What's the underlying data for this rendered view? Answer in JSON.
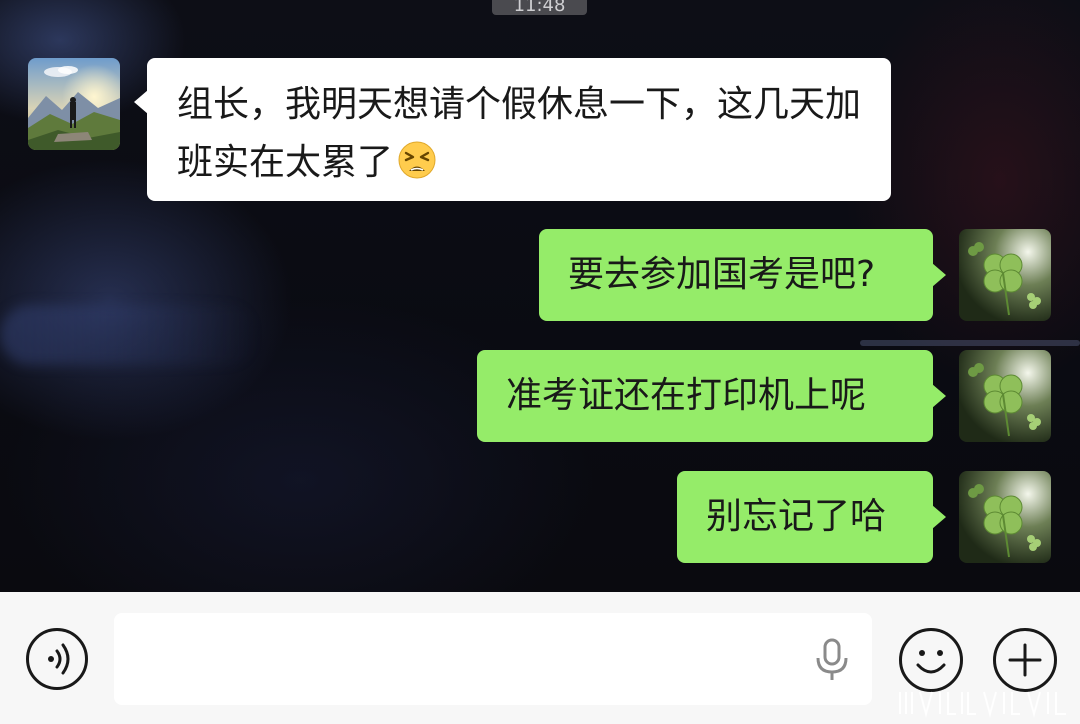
{
  "status": {
    "time": "11:48"
  },
  "messages": [
    {
      "side": "left",
      "sender": "other",
      "text": "组长，我明天想请个假休息一下，这几天加班实在太累了",
      "emoji": "tired-face"
    },
    {
      "side": "right",
      "sender": "me",
      "text": "要去参加国考是吧?"
    },
    {
      "side": "right",
      "sender": "me",
      "text": "准考证还在打印机上呢"
    },
    {
      "side": "right",
      "sender": "me",
      "text": "别忘记了哈"
    }
  ],
  "input_bar": {
    "input_value": "",
    "icons": [
      "voice-icon",
      "mic-icon",
      "emoji-face-icon",
      "plus-icon"
    ]
  },
  "colors": {
    "my_bubble": "#95ec69",
    "their_bubble": "#ffffff",
    "input_bar_bg": "#f7f7f7"
  }
}
